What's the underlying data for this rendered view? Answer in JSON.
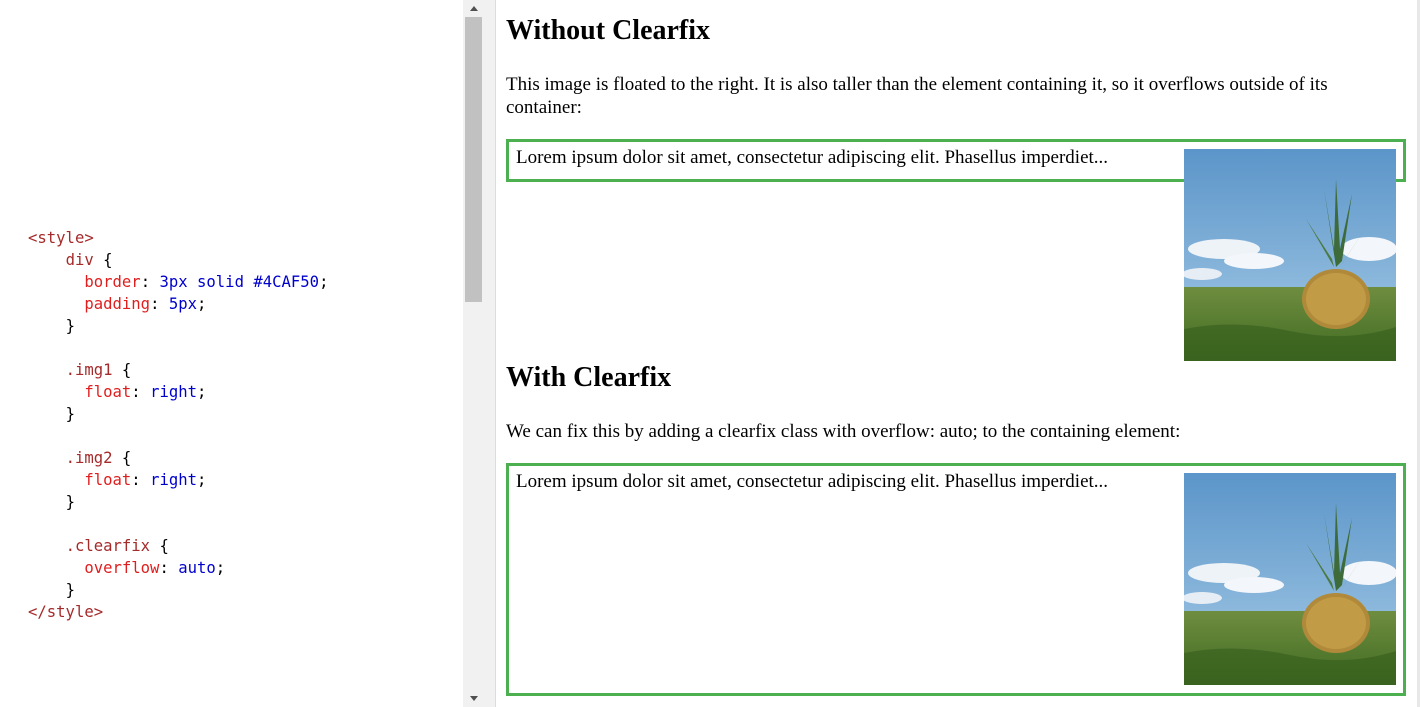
{
  "code": {
    "lines": [
      [
        {
          "t": "<style>",
          "c": "tag"
        }
      ],
      [
        {
          "t": "    "
        },
        {
          "t": "div",
          "c": "sel"
        },
        {
          "t": " {",
          "c": "pn"
        }
      ],
      [
        {
          "t": "      "
        },
        {
          "t": "border",
          "c": "prop"
        },
        {
          "t": ": ",
          "c": "pn"
        },
        {
          "t": "3px solid #4CAF50",
          "c": "val"
        },
        {
          "t": ";",
          "c": "pn"
        }
      ],
      [
        {
          "t": "      "
        },
        {
          "t": "padding",
          "c": "prop"
        },
        {
          "t": ": ",
          "c": "pn"
        },
        {
          "t": "5px",
          "c": "val"
        },
        {
          "t": ";",
          "c": "pn"
        }
      ],
      [
        {
          "t": "    "
        },
        {
          "t": "}",
          "c": "pn"
        }
      ],
      [
        {
          "t": ""
        }
      ],
      [
        {
          "t": "    "
        },
        {
          "t": ".img1",
          "c": "sel"
        },
        {
          "t": " {",
          "c": "pn"
        }
      ],
      [
        {
          "t": "      "
        },
        {
          "t": "float",
          "c": "prop"
        },
        {
          "t": ": ",
          "c": "pn"
        },
        {
          "t": "right",
          "c": "val"
        },
        {
          "t": ";",
          "c": "pn"
        }
      ],
      [
        {
          "t": "    "
        },
        {
          "t": "}",
          "c": "pn"
        }
      ],
      [
        {
          "t": ""
        }
      ],
      [
        {
          "t": "    "
        },
        {
          "t": ".img2",
          "c": "sel"
        },
        {
          "t": " {",
          "c": "pn"
        }
      ],
      [
        {
          "t": "      "
        },
        {
          "t": "float",
          "c": "prop"
        },
        {
          "t": ": ",
          "c": "pn"
        },
        {
          "t": "right",
          "c": "val"
        },
        {
          "t": ";",
          "c": "pn"
        }
      ],
      [
        {
          "t": "    "
        },
        {
          "t": "}",
          "c": "pn"
        }
      ],
      [
        {
          "t": ""
        }
      ],
      [
        {
          "t": "    "
        },
        {
          "t": ".clearfix",
          "c": "sel"
        },
        {
          "t": " {",
          "c": "pn"
        }
      ],
      [
        {
          "t": "      "
        },
        {
          "t": "overflow",
          "c": "prop"
        },
        {
          "t": ": ",
          "c": "pn"
        },
        {
          "t": "auto",
          "c": "val"
        },
        {
          "t": ";",
          "c": "pn"
        }
      ],
      [
        {
          "t": "    "
        },
        {
          "t": "}",
          "c": "pn"
        }
      ],
      [
        {
          "t": "</style>",
          "c": "tag"
        }
      ]
    ]
  },
  "preview": {
    "section1": {
      "heading": "Without Clearfix",
      "paragraph": "This image is floated to the right. It is also taller than the element containing it, so it overflows outside of its container:",
      "box_text": "Lorem ipsum dolor sit amet, consectetur adipiscing elit. Phasellus imperdiet..."
    },
    "section2": {
      "heading": "With Clearfix",
      "paragraph": "We can fix this by adding a clearfix class with overflow: auto; to the containing element:",
      "box_text": "Lorem ipsum dolor sit amet, consectetur adipiscing elit. Phasellus imperdiet..."
    },
    "image_icon": "pineapple-image"
  },
  "colors": {
    "border_green": "#4CAF50",
    "tag": "#a52a2a",
    "property": "#e01e1e",
    "value": "#0000cd"
  }
}
